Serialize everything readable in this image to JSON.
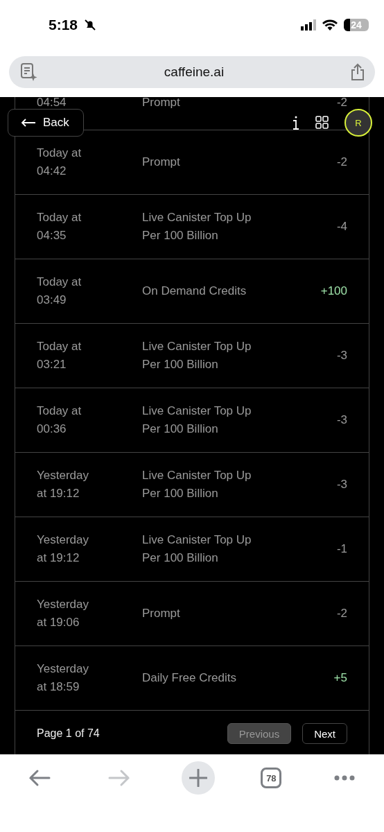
{
  "status_bar": {
    "time": "5:18",
    "battery": "24"
  },
  "address_bar": {
    "url": "caffeine.ai"
  },
  "header": {
    "back": "Back",
    "avatar": "R"
  },
  "transactions": [
    {
      "time": [
        "04:54"
      ],
      "description": [
        "Prompt"
      ],
      "amount": "-2",
      "kind": "debit",
      "partial": true
    },
    {
      "time": [
        "Today at",
        "04:42"
      ],
      "description": [
        "Prompt"
      ],
      "amount": "-2",
      "kind": "debit"
    },
    {
      "time": [
        "Today at",
        "04:35"
      ],
      "description": [
        "Live Canister Top Up",
        "Per 100 Billion"
      ],
      "amount": "-4",
      "kind": "debit"
    },
    {
      "time": [
        "Today at",
        "03:49"
      ],
      "description": [
        "On Demand Credits"
      ],
      "amount": "+100",
      "kind": "credit"
    },
    {
      "time": [
        "Today at",
        "03:21"
      ],
      "description": [
        "Live Canister Top Up",
        "Per 100 Billion"
      ],
      "amount": "-3",
      "kind": "debit"
    },
    {
      "time": [
        "Today at",
        "00:36"
      ],
      "description": [
        "Live Canister Top Up",
        "Per 100 Billion"
      ],
      "amount": "-3",
      "kind": "debit"
    },
    {
      "time": [
        "Yesterday",
        "at 19:12"
      ],
      "description": [
        "Live Canister Top Up",
        "Per 100 Billion"
      ],
      "amount": "-3",
      "kind": "debit"
    },
    {
      "time": [
        "Yesterday",
        "at 19:12"
      ],
      "description": [
        "Live Canister Top Up",
        "Per 100 Billion"
      ],
      "amount": "-1",
      "kind": "debit"
    },
    {
      "time": [
        "Yesterday",
        "at 19:06"
      ],
      "description": [
        "Prompt"
      ],
      "amount": "-2",
      "kind": "debit"
    },
    {
      "time": [
        "Yesterday",
        "at 18:59"
      ],
      "description": [
        "Daily Free Credits"
      ],
      "amount": "+5",
      "kind": "credit"
    }
  ],
  "pagination": {
    "label": "Page 1 of 74",
    "previous": {
      "label": "Previous",
      "disabled": true
    },
    "next": {
      "label": "Next",
      "disabled": false
    }
  },
  "toolbar": {
    "tabs_count": "78",
    "forward_disabled": true
  }
}
